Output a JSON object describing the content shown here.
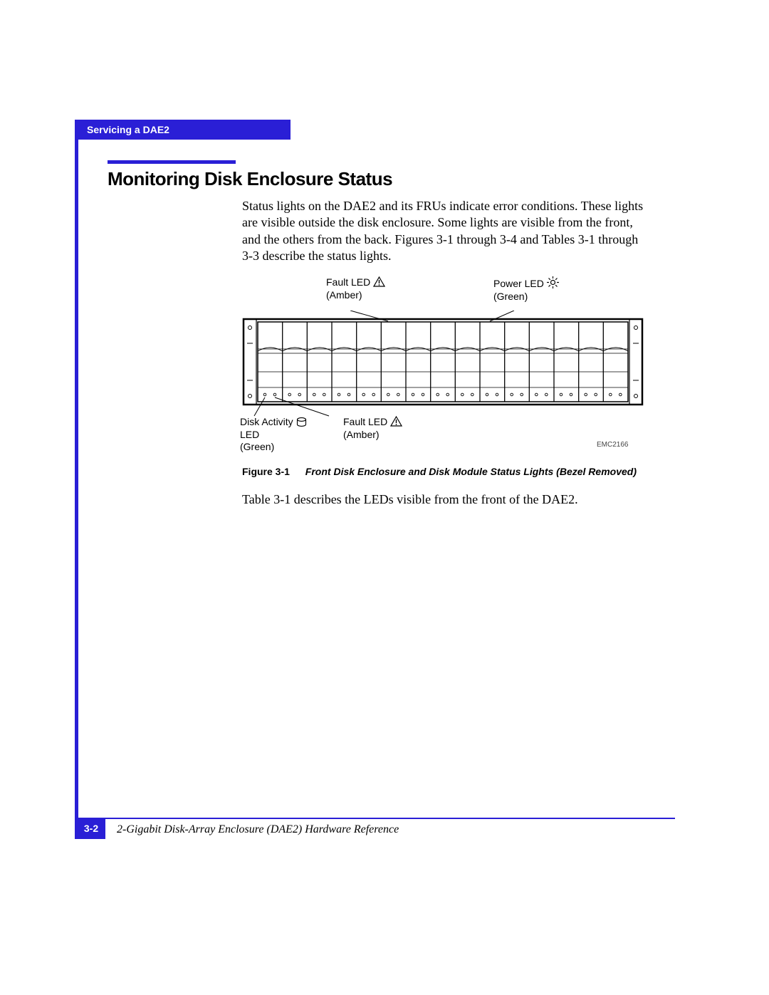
{
  "header": {
    "chapter_tab": "Servicing a DAE2"
  },
  "section": {
    "title": "Monitoring Disk Enclosure Status"
  },
  "body": {
    "para1": "Status lights on the DAE2 and its FRUs indicate error conditions. These lights are visible outside the disk enclosure. Some lights are visible from the front, and the others from the back.  Figures 3-1 through 3-4 and Tables 3-1 through 3-3 describe the status lights.",
    "para2": "Table 3-1 describes the LEDs visible from the front of the DAE2."
  },
  "figure": {
    "labels": {
      "fault_top": "Fault LED",
      "fault_top_sub": "(Amber)",
      "power_top": "Power LED",
      "power_top_sub": "(Green)",
      "activity_bottom": "Disk Activity",
      "activity_bottom_line2": " LED",
      "activity_bottom_sub": "(Green)",
      "fault_bottom": "Fault LED",
      "fault_bottom_sub": "(Amber)",
      "drawing_id": "EMC2166"
    },
    "caption_number": "Figure 3-1",
    "caption_title": "Front Disk Enclosure and Disk Module Status Lights (Bezel Removed)"
  },
  "footer": {
    "page_number": "3-2",
    "doc_title": "2-Gigabit Disk-Array Enclosure (DAE2) Hardware Reference"
  },
  "chart_data": {
    "type": "table",
    "description": "Technical line drawing of the front of a DAE2 disk enclosure with 15 drive bays. Four LEDs are called out.",
    "callouts": [
      {
        "name": "Fault LED",
        "color": "Amber",
        "location": "enclosure front top-left area"
      },
      {
        "name": "Power LED",
        "color": "Green",
        "location": "enclosure front top-right area"
      },
      {
        "name": "Disk Activity LED",
        "color": "Green",
        "location": "per disk module, bottom-left of bay"
      },
      {
        "name": "Fault LED",
        "color": "Amber",
        "location": "per disk module, bottom-right of bay"
      }
    ],
    "bays": 15,
    "drawing_id": "EMC2166"
  }
}
